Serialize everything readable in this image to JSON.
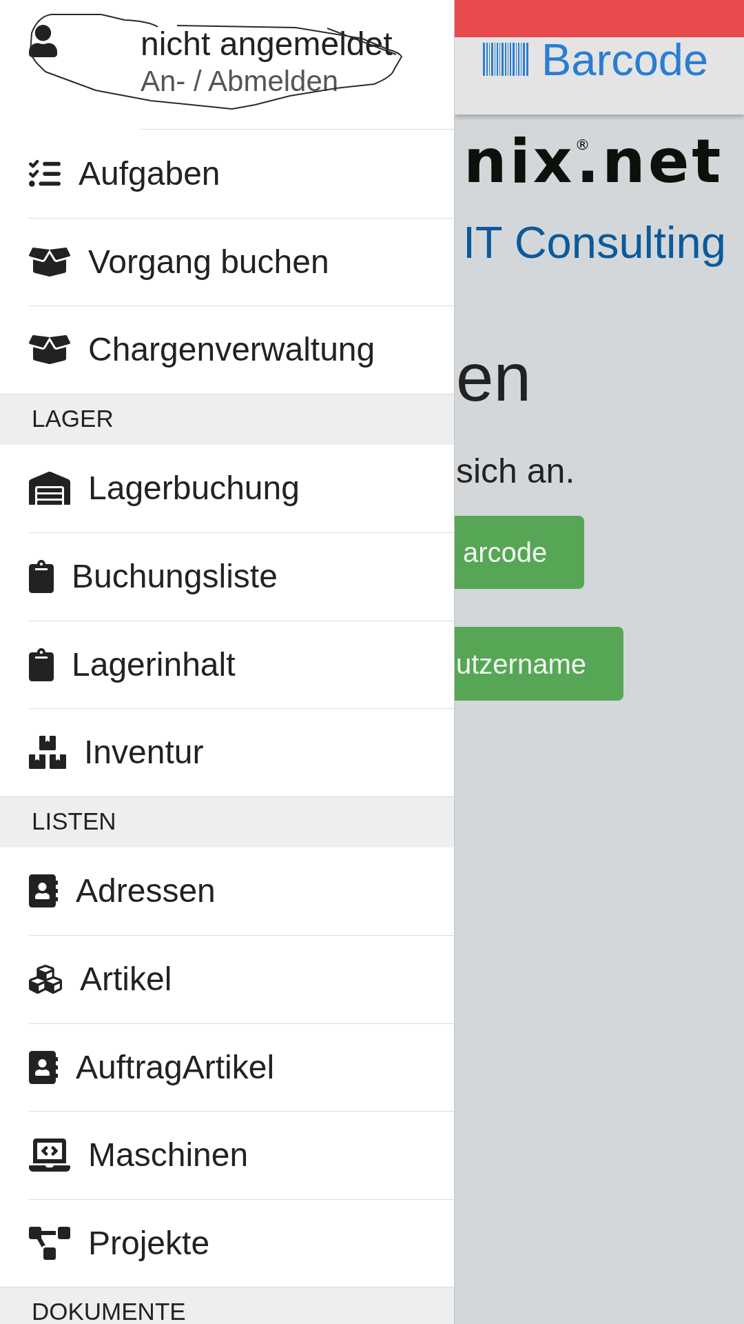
{
  "drawer": {
    "user": {
      "status": "nicht angemeldet",
      "action": "An- / Abmelden"
    },
    "sections": [
      {
        "items": [
          "Aufgaben",
          "Vorgang buchen",
          "Chargenverwaltung"
        ]
      },
      {
        "title": "LAGER",
        "items": [
          "Lagerbuchung",
          "Buchungsliste",
          "Lagerinhalt",
          "Inventur"
        ]
      },
      {
        "title": "LISTEN",
        "items": [
          "Adressen",
          "Artikel",
          "AuftragArtikel",
          "Maschinen",
          "Projekte"
        ]
      },
      {
        "title": "DOKUMENTE"
      }
    ]
  },
  "main": {
    "app_bar": {
      "title": "Barcode"
    },
    "logo": {
      "wordmark": "nix$^{®}$.net",
      "tagline": "IT Consulting"
    },
    "heading": "en",
    "intro": "sich an.",
    "buttons": [
      "arcode",
      "utzername"
    ]
  }
}
